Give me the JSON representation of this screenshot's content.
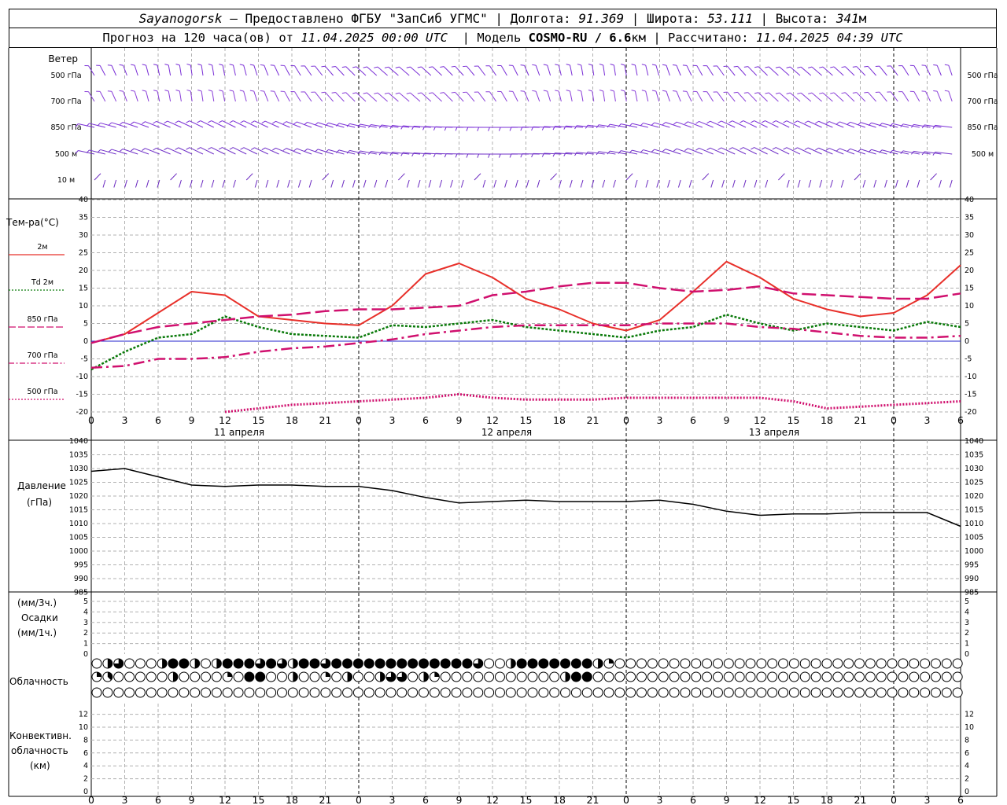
{
  "header": {
    "station": "Sayanogorsk",
    "provider": "— Предоставлено ФГБУ \"ЗапСиб УГМС\"",
    "lon_label": "Долгота:",
    "lon_value": "91.369",
    "lat_label": "Широта:",
    "lat_value": "53.111",
    "alt_label": "Высота:",
    "alt_value": "341",
    "alt_unit": "м",
    "forecast_label": "Прогноз на 120 часа(ов) от",
    "forecast_start": "11.04.2025 00:00 UTC",
    "model_label": "Модель",
    "model_name": "COSMO-RU / 6.6",
    "model_unit": "км",
    "calc_label": "Рассчитано:",
    "calc_time": "11.04.2025 04:39 UTC"
  },
  "wind_panel": {
    "title": "Ветер",
    "levels": [
      "500 гПа",
      "700 гПа",
      "850 гПа",
      "500 м",
      "10  м"
    ]
  },
  "temp_panel": {
    "title": "Тем-ра(°C)",
    "legend": [
      {
        "label": "2м",
        "color": "#e8302a",
        "dash": "solid"
      },
      {
        "label": "Td  2м",
        "color": "#0a7a0a",
        "dash": "dotted"
      },
      {
        "label": "850 гПа",
        "color": "#d0106e",
        "dash": "long-dash"
      },
      {
        "label": "700 гПа",
        "color": "#d0106e",
        "dash": "dash-dot"
      },
      {
        "label": "500 гПа",
        "color": "#d0106e",
        "dash": "dot"
      }
    ],
    "yticks": [
      "40",
      "35",
      "30",
      "25",
      "20",
      "15",
      "10",
      "5",
      "0",
      "-5",
      "-10",
      "-15",
      "-20"
    ]
  },
  "time_axis": {
    "hour_labels": [
      "0",
      "3",
      "6",
      "9",
      "12",
      "15",
      "18",
      "21",
      "0",
      "3",
      "6",
      "9",
      "12",
      "15",
      "18",
      "21",
      "0",
      "3",
      "6",
      "9",
      "12",
      "15",
      "18",
      "21",
      "0",
      "3",
      "6"
    ],
    "dates": [
      "11 апреля",
      "12 апреля",
      "13 апреля"
    ]
  },
  "pressure_panel": {
    "title": "Давление",
    "unit": "(гПа)",
    "yticks": [
      "1040",
      "1035",
      "1030",
      "1025",
      "1020",
      "1015",
      "1010",
      "1005",
      "1000",
      "995",
      "990",
      "985"
    ]
  },
  "precip_panel": {
    "unit_top": "(мм/3ч.)",
    "title": "Осадки",
    "unit_bottom": "(мм/1ч.)",
    "yticks": [
      "5",
      "4",
      "3",
      "2",
      "1",
      "0"
    ]
  },
  "cloud_panel": {
    "title": "Облачность"
  },
  "convective_panel": {
    "title_1": "Конвективн.",
    "title_2": "облачность",
    "unit": "(км)",
    "yticks": [
      "12",
      "10",
      "8",
      "6",
      "4",
      "2",
      "0"
    ]
  },
  "chart_data": [
    {
      "type": "line",
      "title": "Тем-ра(°C)",
      "x_hours_step": 3,
      "x_hours": [
        0,
        3,
        6,
        9,
        12,
        15,
        18,
        21,
        24,
        27,
        30,
        33,
        36,
        39,
        42,
        45,
        48,
        51,
        54,
        57,
        60,
        63,
        66,
        69,
        72,
        75,
        78
      ],
      "ylim": [
        -20,
        40
      ],
      "series": [
        {
          "name": "2м",
          "values": [
            -0.5,
            2,
            8,
            14,
            13,
            7,
            6,
            5,
            4.5,
            10,
            19,
            22,
            18,
            12,
            9,
            5,
            3,
            6,
            14,
            22.5,
            18,
            12,
            9,
            7,
            8,
            13,
            21.5
          ]
        },
        {
          "name": "Td  2м",
          "values": [
            -8,
            -3,
            1,
            2,
            7,
            4,
            2,
            1.5,
            1,
            4.5,
            4,
            5,
            6,
            4,
            3,
            2,
            1,
            3,
            4,
            7.5,
            5,
            3,
            5,
            4,
            3,
            5.5,
            4
          ]
        },
        {
          "name": "850 гПа",
          "values": [
            -0.5,
            2,
            4,
            5,
            6,
            7,
            7.5,
            8.5,
            9,
            9,
            9.5,
            10,
            13,
            14,
            15.5,
            16.5,
            16.5,
            15,
            14,
            14.5,
            15.5,
            13.5,
            13,
            12.5,
            12,
            12,
            13.5
          ]
        },
        {
          "name": "700 гПа",
          "values": [
            -7.5,
            -7,
            -5,
            -5,
            -4.5,
            -3,
            -2,
            -1.5,
            -0.5,
            0.5,
            2,
            3,
            4,
            4.5,
            4.5,
            4.5,
            4.5,
            5,
            5,
            5,
            4,
            3.5,
            2.5,
            1.5,
            1,
            1,
            1.5
          ]
        },
        {
          "name": "500 гПа",
          "values": [
            null,
            null,
            null,
            null,
            -20,
            -19,
            -18,
            -17.5,
            -17,
            -16.5,
            -16,
            -15,
            -16,
            -16.5,
            -16.5,
            -16.5,
            -16,
            -16,
            -16,
            -16,
            -16,
            -17,
            -19,
            -18.5,
            -18,
            -17.5,
            -17
          ]
        }
      ]
    },
    {
      "type": "line",
      "title": "Давление",
      "x_hours": [
        0,
        3,
        6,
        9,
        12,
        15,
        18,
        21,
        24,
        27,
        30,
        33,
        36,
        39,
        42,
        45,
        48,
        51,
        54,
        57,
        60,
        63,
        66,
        69,
        72,
        75,
        78
      ],
      "ylim": [
        985,
        1040
      ],
      "series": [
        {
          "name": "Давление",
          "values": [
            1029,
            1030,
            1027,
            1024,
            1023.5,
            1024,
            1024,
            1023.5,
            1023.5,
            1022,
            1019.5,
            1017.5,
            1018,
            1018.5,
            1018,
            1018,
            1018,
            1018.5,
            1017,
            1014.5,
            1013,
            1013.5,
            1013.5,
            1014,
            1014,
            1014,
            1009
          ]
        }
      ]
    },
    {
      "type": "bar",
      "title": "Осадки",
      "x_hours": [
        0,
        3,
        6,
        9,
        12,
        15,
        18,
        21,
        24,
        27,
        30,
        33,
        36,
        39,
        42,
        45,
        48,
        51,
        54,
        57,
        60,
        63,
        66,
        69,
        72,
        75,
        78
      ],
      "ylim": [
        0,
        5
      ],
      "values": [
        0,
        0,
        0,
        0,
        0,
        0,
        0,
        0,
        0,
        0,
        0,
        0,
        0,
        0,
        0,
        0,
        0,
        0,
        0,
        0,
        0,
        0,
        0,
        0,
        0,
        0,
        0
      ]
    },
    {
      "type": "table",
      "title": "Облачность",
      "rows_oktas": [
        [
          0,
          4,
          6,
          0,
          0,
          0,
          4,
          8,
          8,
          4,
          0,
          4,
          8,
          8,
          8,
          6,
          8,
          6,
          4,
          8,
          8,
          6,
          8,
          8,
          8,
          8,
          8,
          8,
          8,
          8,
          8,
          8,
          8,
          8,
          8,
          6,
          0,
          0,
          4,
          8,
          8,
          8,
          8,
          8,
          8,
          8,
          4,
          2,
          0,
          0,
          0,
          0,
          0,
          0,
          0,
          0,
          0,
          0,
          0,
          0,
          0,
          0,
          0,
          0,
          0,
          0,
          0,
          0,
          0,
          0,
          0,
          0,
          0,
          0,
          0,
          0,
          0,
          0,
          0,
          0
        ],
        [
          2,
          3,
          0,
          0,
          0,
          0,
          0,
          4,
          0,
          0,
          0,
          0,
          2,
          0,
          8,
          8,
          0,
          0,
          4,
          0,
          0,
          2,
          0,
          4,
          0,
          0,
          4,
          6,
          6,
          0,
          4,
          2,
          0,
          0,
          0,
          0,
          0,
          0,
          0,
          0,
          0,
          0,
          0,
          4,
          8,
          8,
          0,
          0,
          0,
          0,
          0,
          0,
          0,
          0,
          0,
          0,
          0,
          0,
          0,
          0,
          0,
          0,
          0,
          0,
          0,
          0,
          0,
          0,
          0,
          0,
          0,
          0,
          0,
          0,
          0,
          0,
          0,
          0,
          0,
          0
        ],
        [
          0,
          0,
          0,
          0,
          0,
          0,
          0,
          0,
          0,
          0,
          0,
          0,
          0,
          0,
          0,
          0,
          0,
          0,
          0,
          0,
          0,
          0,
          0,
          0,
          0,
          0,
          0,
          0,
          0,
          0,
          0,
          0,
          0,
          0,
          0,
          0,
          0,
          0,
          0,
          0,
          0,
          0,
          0,
          0,
          0,
          0,
          0,
          0,
          0,
          0,
          0,
          0,
          0,
          0,
          0,
          0,
          0,
          0,
          0,
          0,
          0,
          0,
          0,
          0,
          0,
          0,
          0,
          0,
          0,
          0,
          0,
          0,
          0,
          0,
          0,
          0,
          0,
          0,
          0,
          0
        ]
      ]
    },
    {
      "type": "bar",
      "title": "Конвективн. облачность",
      "ylim": [
        0,
        13
      ],
      "values": []
    }
  ]
}
